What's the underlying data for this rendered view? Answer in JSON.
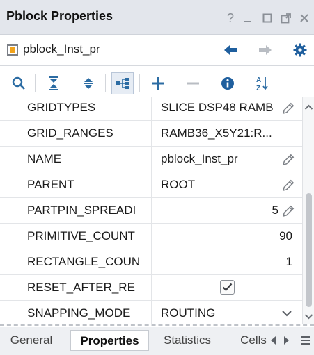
{
  "window": {
    "title": "Pblock Properties",
    "help_label": "?"
  },
  "object": {
    "name": "pblock_Inst_pr",
    "icon": "pblock-orange-square-icon"
  },
  "toolbar": {
    "icons": [
      "search-icon",
      "collapse-all-icon",
      "expand-all-icon",
      "group-tree-icon",
      "add-icon",
      "remove-icon",
      "info-icon",
      "sort-az-icon"
    ]
  },
  "properties": [
    {
      "name": "GRIDTYPES",
      "value": "SLICE DSP48 RAMB",
      "align": "left",
      "editable": true
    },
    {
      "name": "GRID_RANGES",
      "value": "RAMB36_X5Y21:R...",
      "align": "left",
      "editable": false
    },
    {
      "name": "NAME",
      "value": "pblock_Inst_pr",
      "align": "left",
      "editable": true
    },
    {
      "name": "PARENT",
      "value": "ROOT",
      "align": "left",
      "editable": true
    },
    {
      "name": "PARTPIN_SPREADI",
      "value": "5",
      "align": "right",
      "editable": true
    },
    {
      "name": "PRIMITIVE_COUNT",
      "value": "90",
      "align": "right",
      "editable": false
    },
    {
      "name": "RECTANGLE_COUN",
      "value": "1",
      "align": "right",
      "editable": false
    },
    {
      "name": "RESET_AFTER_RE",
      "value": "",
      "type": "checkbox",
      "checked": true
    },
    {
      "name": "SNAPPING_MODE",
      "value": "ROUTING",
      "type": "dropdown"
    }
  ],
  "tabs": [
    {
      "label": "General",
      "active": false
    },
    {
      "label": "Properties",
      "active": true
    },
    {
      "label": "Statistics",
      "active": false
    },
    {
      "label": "Cells",
      "active": false
    }
  ],
  "colors": {
    "pblock_icon": "#f2a31b",
    "nav_blue": "#1f5f9e",
    "toolbar_icon": "#2c6ca3"
  }
}
